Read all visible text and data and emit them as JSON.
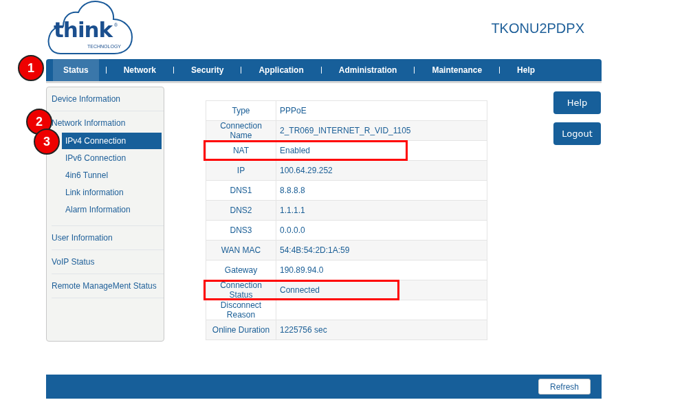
{
  "logo": {
    "name": "think",
    "registered": "®",
    "tagline": "TECHNOLOGY"
  },
  "device_name": "TKONU2PDPX",
  "nav_marker": "1",
  "nav_tabs": [
    {
      "label": "Status",
      "selected": true
    },
    {
      "label": "Network",
      "selected": false
    },
    {
      "label": "Security",
      "selected": false
    },
    {
      "label": "Application",
      "selected": false
    },
    {
      "label": "Administration",
      "selected": false
    },
    {
      "label": "Maintenance",
      "selected": false
    },
    {
      "label": "Help",
      "selected": false
    }
  ],
  "sidebar": {
    "items": [
      {
        "label": "Device Information",
        "selected": false
      },
      {
        "label": "Network Information",
        "selected": false,
        "marker": "2",
        "children": [
          {
            "label": "IPv4 Connection",
            "selected": true,
            "marker": "3"
          },
          {
            "label": "IPv6 Connection",
            "selected": false
          },
          {
            "label": "4in6 Tunnel",
            "selected": false
          },
          {
            "label": "Link information",
            "selected": false
          },
          {
            "label": "Alarm Information",
            "selected": false
          }
        ]
      },
      {
        "label": "User Information",
        "selected": false
      },
      {
        "label": "VoIP Status",
        "selected": false
      },
      {
        "label": "Remote ManageMent Status",
        "selected": false
      }
    ]
  },
  "connection_table": {
    "rows": [
      {
        "label": "Type",
        "value": "PPPoE",
        "highlighted": false
      },
      {
        "label": "Connection Name",
        "value": "2_TR069_INTERNET_R_VID_1105",
        "highlighted": false
      },
      {
        "label": "NAT",
        "value": "Enabled",
        "highlighted": true
      },
      {
        "label": "IP",
        "value": "100.64.29.252",
        "highlighted": false
      },
      {
        "label": "DNS1",
        "value": "8.8.8.8",
        "highlighted": false
      },
      {
        "label": "DNS2",
        "value": "1.1.1.1",
        "highlighted": false
      },
      {
        "label": "DNS3",
        "value": "0.0.0.0",
        "highlighted": false
      },
      {
        "label": "WAN MAC",
        "value": "54:4B:54:2D:1A:59",
        "highlighted": false
      },
      {
        "label": "Gateway",
        "value": "190.89.94.0",
        "highlighted": false
      },
      {
        "label": "Connection Status",
        "value": "Connected",
        "highlighted": true
      },
      {
        "label": "Disconnect Reason",
        "highlighted": false
      },
      {
        "label": "Online Duration",
        "value": "1225756 sec",
        "highlighted": false
      }
    ]
  },
  "side_buttons": [
    "Help",
    "Logout"
  ],
  "footer": {
    "button": "Refresh"
  }
}
